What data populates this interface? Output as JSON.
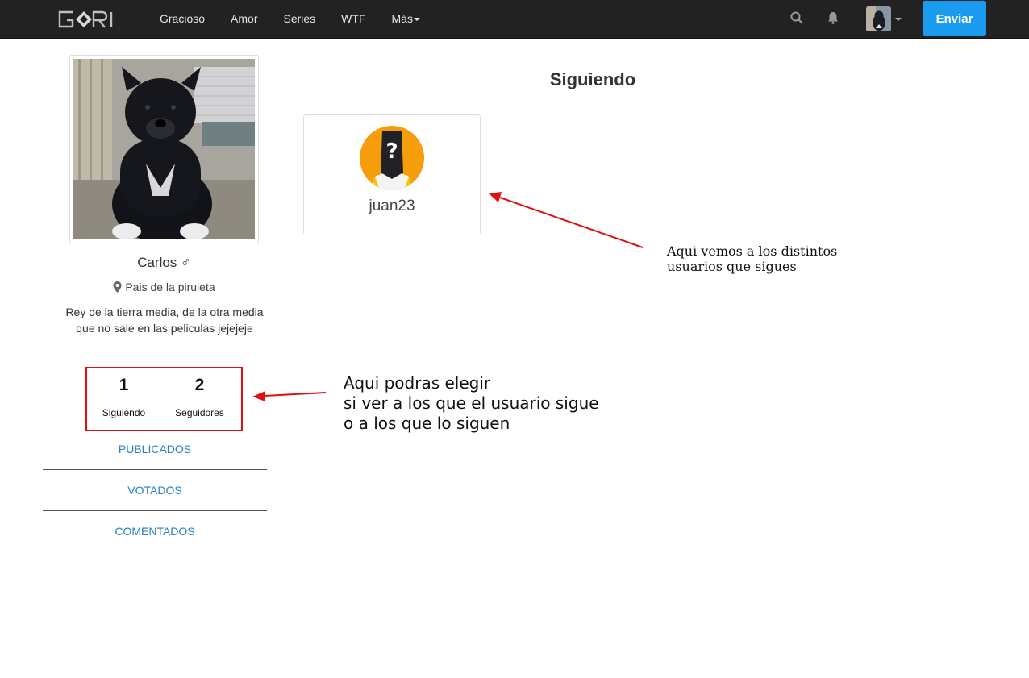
{
  "navbar": {
    "logo_text": "GORI",
    "links": [
      {
        "label": "Gracioso"
      },
      {
        "label": "Amor"
      },
      {
        "label": "Series"
      },
      {
        "label": "WTF"
      },
      {
        "label": "Más"
      }
    ],
    "search_icon": "search-icon",
    "notifications_icon": "bell-icon",
    "send_label": "Enviar",
    "colors": {
      "background": "#222222",
      "accent": "#1a9bf0"
    }
  },
  "profile": {
    "name": "Carlos ♂",
    "location": "Pais de la piruleta",
    "bio": "Rey de la tierra media, de la otra media que no sale en las peliculas jejejeje",
    "stats": {
      "following_count": "1",
      "following_label": "Siguiendo",
      "followers_count": "2",
      "followers_label": "Seguidores"
    },
    "nav": [
      {
        "label": "PUBLICADOS"
      },
      {
        "label": "VOTADOS"
      },
      {
        "label": "COMENTADOS"
      }
    ],
    "colors": {
      "link": "#2a7fc2",
      "highlight": "#e01010"
    }
  },
  "main": {
    "title": "Siguiendo",
    "users": [
      {
        "username": "juan23",
        "avatar_icon": "anonymous-user-icon"
      }
    ]
  },
  "annotations": {
    "following_note": [
      "Aqui vemos a los distintos",
      "usuarios que sigues"
    ],
    "stats_note": [
      "Aqui podras elegir",
      "si ver a los que el usuario sigue",
      "o a los que lo siguen"
    ]
  }
}
